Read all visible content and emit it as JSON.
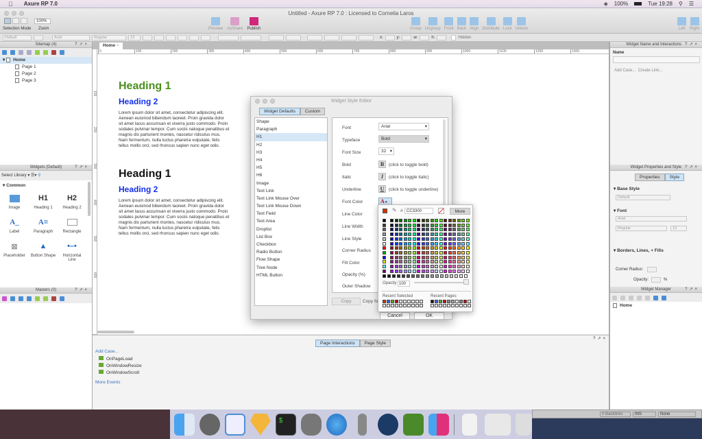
{
  "menubar": {
    "app": "Axure RP 7.0",
    "battery": "100%",
    "clock": "Tue 19:28"
  },
  "window": {
    "title": "Untitled - Axure RP 7.0 : Licensed to Cornelia Laros"
  },
  "toolbar": {
    "selection_mode": "Selection Mode",
    "zoom_label": "Zoom",
    "zoom_value": "100%",
    "preview": "Preview",
    "axshare": "AxShare",
    "publish": "Publish",
    "group": "Group",
    "ungroup": "Ungroup",
    "front": "Front",
    "back": "Back",
    "align": "Align",
    "distribute": "Distribute",
    "lock": "Lock",
    "unlock": "Unlock",
    "left": "Left",
    "right": "Right"
  },
  "format_bar": {
    "style": "Default",
    "font": "Arial",
    "typeface": "Regular",
    "size": "13",
    "x": "x:",
    "y": "y:",
    "w": "w:",
    "h": "h:",
    "hidden": "Hidden"
  },
  "sitemap": {
    "title": "Sitemap (4)",
    "root": "Home",
    "pages": [
      "Page 1",
      "Page 2",
      "Page 3"
    ]
  },
  "widgets": {
    "title": "Widgets (Default)",
    "select_library": "Select Library",
    "category": "Common",
    "items": [
      "Image",
      "Heading 1",
      "Heading 2",
      "Label",
      "Paragraph",
      "Rectangle",
      "Placeholder",
      "Button Shape",
      "Horizontal Line"
    ],
    "h1_glyph": "H1",
    "h2_glyph": "H2"
  },
  "masters": {
    "title": "Masters (0)"
  },
  "canvas": {
    "tab": "Home",
    "ruler": [
      "0",
      "100",
      "200",
      "300",
      "400",
      "500",
      "600",
      "700",
      "800",
      "900",
      "1000",
      "1100",
      "1200",
      "1300"
    ],
    "vruler": [
      "100",
      "200",
      "300",
      "400",
      "500",
      "600"
    ],
    "heading1": "Heading 1",
    "heading2": "Heading 2",
    "lorem": "Lorem ipsum dolor sit amet, consectetur adipiscing elit. Aenean euismod bibendum laoreet. Proin gravida dolor sit amet lacus accumsan et viverra justo commodo. Proin sodales pulvinar tempor. Cum sociis natoque penatibus et magnis dis parturient montes, nascetur ridiculus mus. Nam fermentum, nulla luctus pharetra vulputate, felis tellus mollis orci, sed rhoncus sapien nunc eget odio.",
    "heading1_color": "#4a8f1e",
    "heading2_color": "#1430e8"
  },
  "dialog": {
    "title": "Widget Style Editor",
    "tabs": [
      "Widget Defaults",
      "Custom"
    ],
    "styles": [
      "Shape",
      "Paragraph",
      "H1",
      "H2",
      "H3",
      "H4",
      "H5",
      "H6",
      "Image",
      "Text Link",
      "Text Link Mouse Over",
      "Text Link Mouse Down",
      "Text Field",
      "Text Area",
      "Droplist",
      "List Box",
      "Checkbox",
      "Radio Button",
      "Flow Shape",
      "Tree Node",
      "HTML Button"
    ],
    "selected": "H1",
    "props": {
      "font": "Font",
      "font_value": "Arial",
      "typeface": "Typeface",
      "typeface_value": "Bold",
      "font_size": "Font Size",
      "font_size_value": "32",
      "bold": "Bold",
      "bold_hint": "(click to toggle bold)",
      "italic": "Italic",
      "italic_hint": "(click to toggle italic)",
      "underline": "Underline",
      "underline_hint": "(click to toggle underline)",
      "font_color": "Font Color",
      "line_color": "Line Color",
      "line_width": "Line Width",
      "line_style": "Line Style",
      "corner_radius": "Corner Radius",
      "fill_color": "Fill Color",
      "opacity": "Opacity (%)",
      "outer_shadow": "Outer Shadow"
    },
    "copy": "Copy",
    "copy_for": "Copy for",
    "cancel": "Cancel",
    "ok": "OK"
  },
  "color_picker": {
    "hex_label": "#",
    "hex": "CC3300",
    "current": "#cc3300",
    "more": "More",
    "opacity_label": "Opacity",
    "opacity": "100",
    "recent_selected": "Recent Selected",
    "recent_pages": "Recent Pages",
    "recent_selected_colors": [
      "#cc3300",
      "#3366ff",
      "#66aa22",
      "#cc0000"
    ],
    "recent_pages_colors": [
      "#111111",
      "#3366ff",
      "#66aa22",
      "#cc0000",
      "#888888",
      "#aaaaaa",
      "#ffffff",
      "#888888",
      "#cc0000"
    ],
    "side_colors": [
      "#000000",
      "#333333",
      "#666666",
      "#999999",
      "#cccccc",
      "#ffffff",
      "#ff0000",
      "#00aa00",
      "#0000ff",
      "#ffff00",
      "#66ffff",
      "#660066"
    ]
  },
  "bottom_panel": {
    "tabs": [
      "Page Interactions",
      "Page Style"
    ],
    "add_case": "Add Case...",
    "events": [
      "OnPageLoad",
      "OnWindowResize",
      "OnWindowScroll"
    ],
    "more_events": "More Events"
  },
  "right": {
    "name_panel": "Widget Name and Interactions",
    "name_label": "Name",
    "add_case": "Add Case...",
    "create_link": "Create Link...",
    "props_panel": "Widget Properties and Style",
    "tabs": [
      "Properties",
      "Style"
    ],
    "base_style": "Base Style",
    "base_value": "Default",
    "font": "Font",
    "font_value": "Arial",
    "typeface": "Regular",
    "size": "13",
    "borders": "Borders, Lines, + Fills",
    "corner_radius": "Corner Radius:",
    "opacity": "Opacity:",
    "percent": "%",
    "manager": "Widget Manager",
    "manager_root": "Home"
  },
  "status": {
    "backlinks": "0 Backlinks",
    "ins": "INS",
    "none": "None"
  }
}
